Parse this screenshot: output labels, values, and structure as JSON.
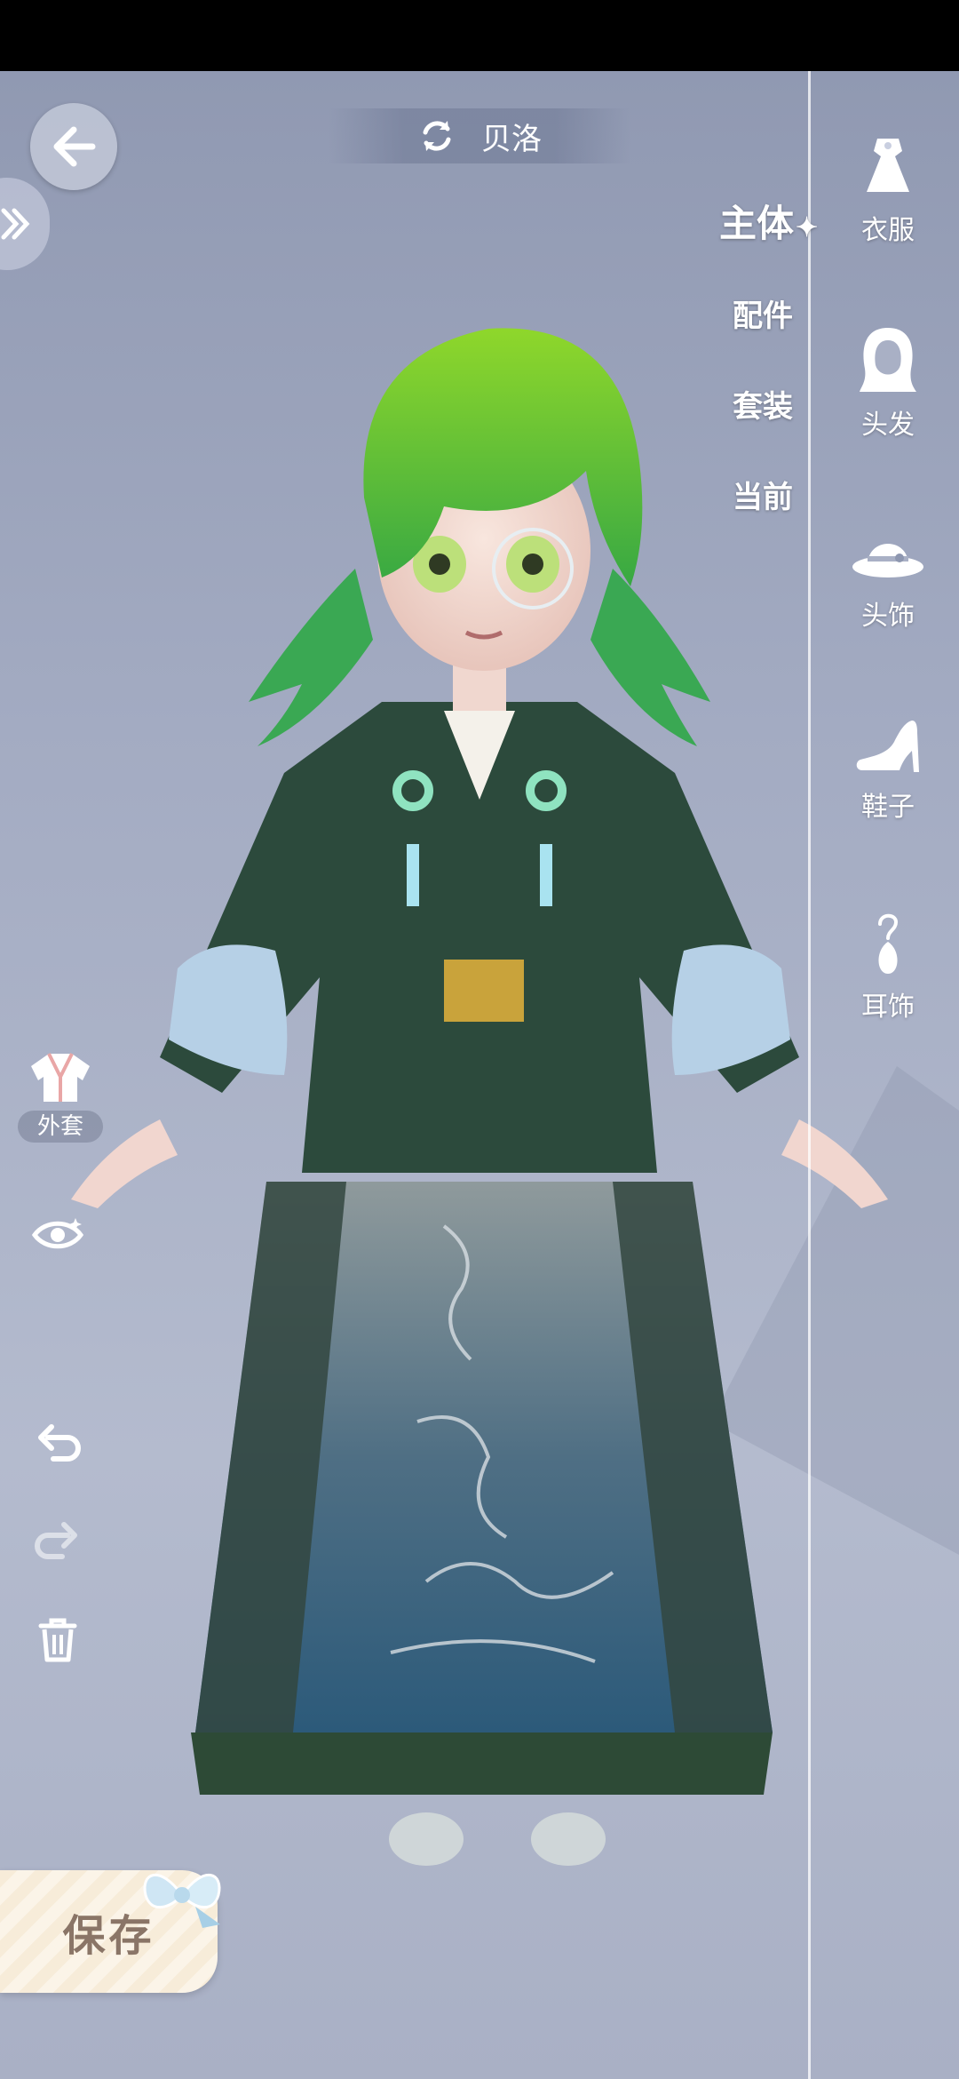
{
  "header": {
    "character_name": "贝洛"
  },
  "categories": [
    {
      "label": "主体",
      "active": true
    },
    {
      "label": "配件",
      "active": false
    },
    {
      "label": "套装",
      "active": false
    },
    {
      "label": "当前",
      "active": false
    }
  ],
  "right_panel": {
    "items": [
      {
        "label": "衣服",
        "icon": "dress-icon"
      },
      {
        "label": "头发",
        "icon": "hair-icon"
      },
      {
        "label": "头饰",
        "icon": "hat-icon"
      },
      {
        "label": "鞋子",
        "icon": "high-heel-icon"
      },
      {
        "label": "耳饰",
        "icon": "earring-icon"
      }
    ]
  },
  "left_tools": {
    "coat_label": "外套"
  },
  "save": {
    "label": "保存"
  },
  "colors": {
    "background": "#a3abc2",
    "accent_text": "#ffffff",
    "save_text": "#8a7567"
  }
}
